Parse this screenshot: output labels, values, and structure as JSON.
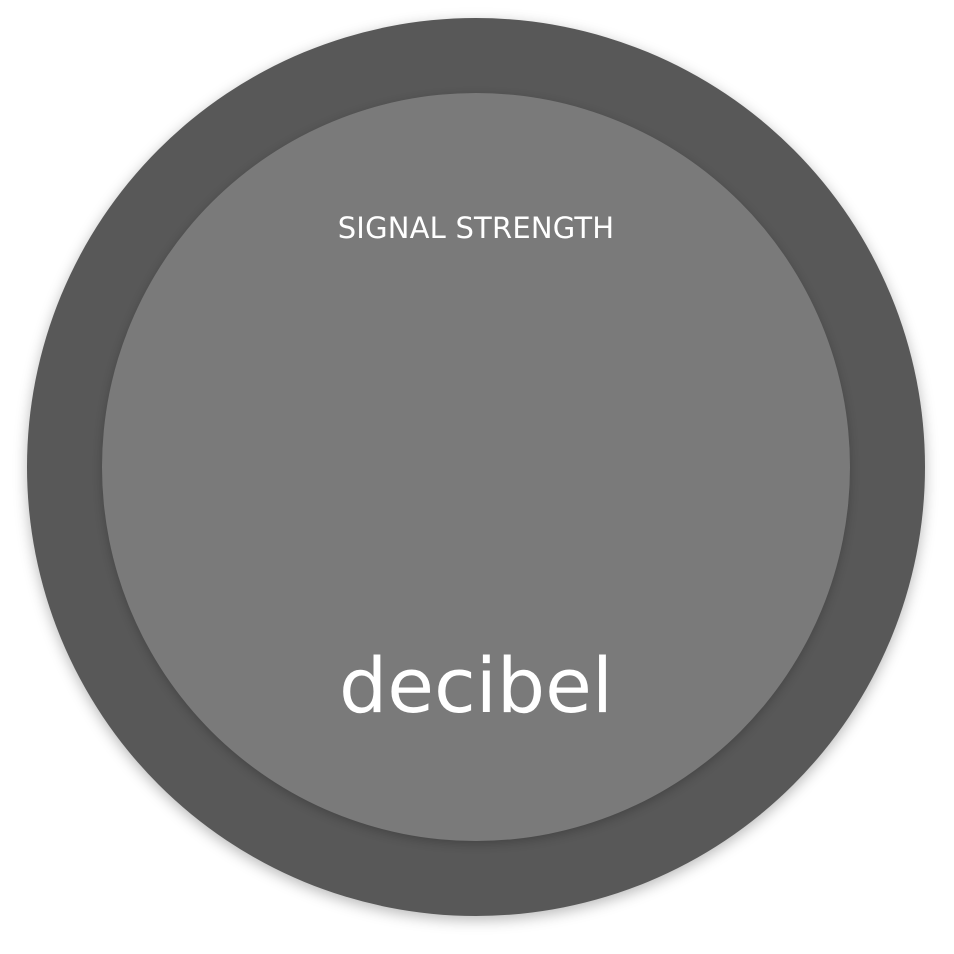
{
  "gauge": {
    "title": "SIGNAL STRENGTH",
    "unit": "decibel",
    "colors": {
      "outer_ring": "#585858",
      "inner_face": "#7a7a7a",
      "text": "#ffffff",
      "background": "#ffffff"
    }
  }
}
